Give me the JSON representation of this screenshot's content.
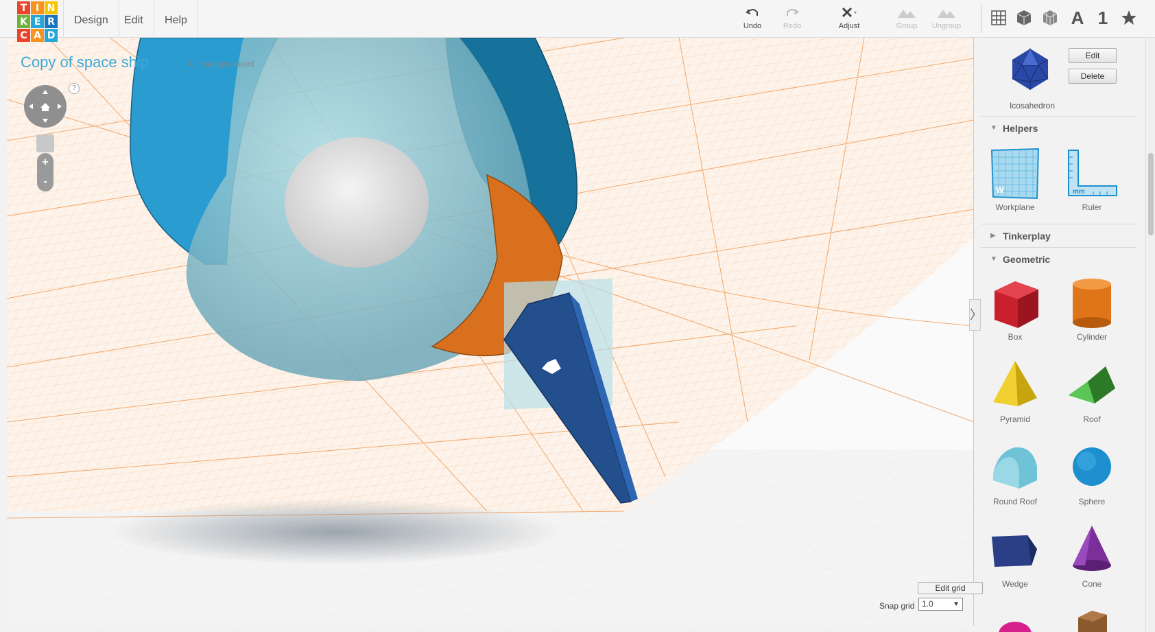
{
  "app": {
    "logo_letters": [
      "T",
      "I",
      "N",
      "K",
      "E",
      "R",
      "C",
      "A",
      "D"
    ],
    "logo_colors": [
      "#e8452b",
      "#f7931e",
      "#f7c500",
      "#6cb33e",
      "#27a7d8",
      "#1875be",
      "#e8452b",
      "#f7931e",
      "#27a7d8"
    ]
  },
  "menu": [
    {
      "label": "Design"
    },
    {
      "label": "Edit"
    },
    {
      "label": "Help"
    }
  ],
  "toolbar": {
    "undo_label": "Undo",
    "redo_label": "Redo",
    "adjust_label": "Adjust",
    "group_label": "Group",
    "ungroup_label": "Ungroup",
    "view_text_label": "A",
    "view_number_label": "1"
  },
  "document": {
    "title": "Copy of space ship",
    "status": "All changes saved"
  },
  "navigation": {
    "help_label": "?",
    "zoom_in_label": "+",
    "zoom_out_label": "-"
  },
  "grid": {
    "edit_grid_label": "Edit grid",
    "snap_grid_label": "Snap grid",
    "snap_grid_value": "1.0"
  },
  "sidebar": {
    "selected_shape": {
      "name": "Icosahedron",
      "edit_label": "Edit",
      "delete_label": "Delete"
    },
    "sections": [
      {
        "title": "Helpers",
        "expanded": true
      },
      {
        "title": "Tinkerplay",
        "expanded": false
      },
      {
        "title": "Geometric",
        "expanded": true
      }
    ],
    "helpers": [
      {
        "label": "Workplane",
        "icon": "workplane-icon"
      },
      {
        "label": "Ruler",
        "icon": "ruler-icon"
      }
    ],
    "geometric": [
      {
        "label": "Box",
        "color": "#c8202c"
      },
      {
        "label": "Cylinder",
        "color": "#e07418"
      },
      {
        "label": "Pyramid",
        "color": "#e8c419"
      },
      {
        "label": "Roof",
        "color": "#3fa03a"
      },
      {
        "label": "Round Roof",
        "color": "#6ec3d6"
      },
      {
        "label": "Sphere",
        "color": "#1d8fcf"
      },
      {
        "label": "Wedge",
        "color": "#2a3f86"
      },
      {
        "label": "Cone",
        "color": "#7b2f9a"
      }
    ]
  },
  "colors": {
    "accent": "#3fa8d6",
    "grid_line": "#f0a060"
  }
}
